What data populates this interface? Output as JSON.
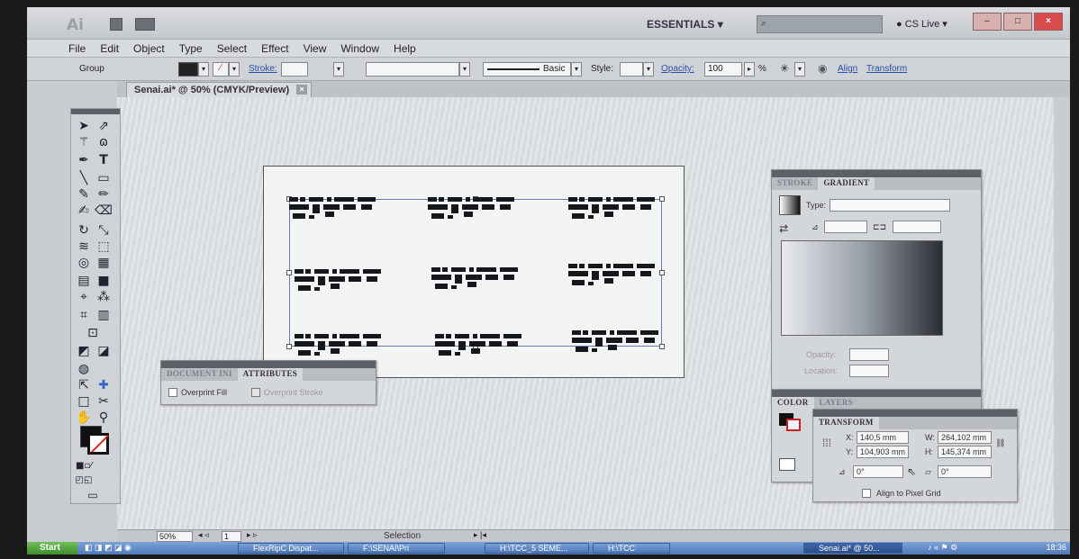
{
  "titlebar": {
    "workspace": "ESSENTIALS",
    "cslive": "CS Live"
  },
  "menu": [
    "File",
    "Edit",
    "Object",
    "Type",
    "Select",
    "Effect",
    "View",
    "Window",
    "Help"
  ],
  "control": {
    "selection_kind": "Group",
    "stroke_label": "Stroke:",
    "brush_label": "Basic",
    "style_label": "Style:",
    "opacity_label": "Opacity:",
    "opacity_value": "100",
    "opacity_unit": "%",
    "align_link": "Align",
    "transform_link": "Transform"
  },
  "document": {
    "tab_title": "Senai.ai* @ 50% (CMYK/Preview)"
  },
  "gradient_panel": {
    "tab_stroke": "STROKE",
    "tab_gradient": "GRADIENT",
    "type_label": "Type:",
    "opacity_label": "Opacity:",
    "location_label": "Location:"
  },
  "attributes_panel": {
    "tab_doc": "DOCUMENT INI",
    "tab_attr": "ATTRIBUTES",
    "overprint_fill": "Overprint Fill",
    "overprint_stroke": "Overprint Stroke"
  },
  "color_panel": {
    "tab_color": "COLOR",
    "tab_layers": "LAYERS"
  },
  "transform_panel": {
    "title": "TRANSFORM",
    "x_label": "X:",
    "x_value": "140,5 mm",
    "y_label": "Y:",
    "y_value": "104,903 mm",
    "w_label": "W:",
    "w_value": "264,102 mm",
    "h_label": "H:",
    "h_value": "145,374 mm",
    "rotate_value": "0°",
    "shear_value": "0°",
    "align_pixel": "Align to Pixel Grid"
  },
  "status": {
    "zoom": "50%",
    "artboard_num": "1",
    "tool": "Selection"
  },
  "taskbar": {
    "start": "Start",
    "tasks": [
      "FlexRipC Dispat...",
      "F:\\SENAI\\Pri",
      "H:\\TCC_5 SEME...",
      "H:\\TCC",
      "Senai.ai* @ 50..."
    ],
    "clock": "18:36"
  },
  "colors": {
    "link": "#2a4fa8",
    "close": "#d94a4a",
    "none_slash": "#d22222"
  }
}
